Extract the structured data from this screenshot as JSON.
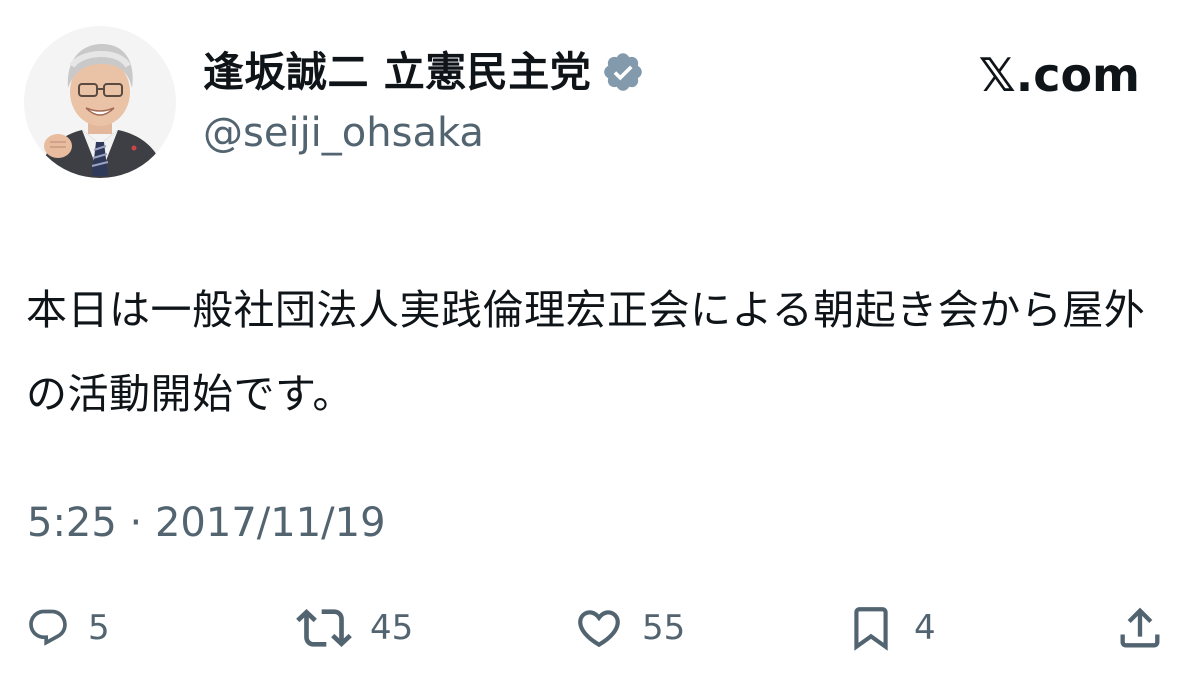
{
  "author": {
    "display_name": "逢坂誠二 立憲民主党",
    "handle": "@seiji_ohsaka",
    "verified": true,
    "verified_color": "#829aab"
  },
  "brand": {
    "label": "𝕏.com"
  },
  "tweet": {
    "text": "本日は一般社団法人実践倫理宏正会による朝起き会から屋外の活動開始です。",
    "timestamp": "5:25 · 2017/11/19"
  },
  "actions": {
    "reply": {
      "icon": "reply-icon",
      "count": "5"
    },
    "retweet": {
      "icon": "retweet-icon",
      "count": "45"
    },
    "like": {
      "icon": "heart-icon",
      "count": "55"
    },
    "bookmark": {
      "icon": "bookmark-icon",
      "count": "4"
    },
    "share": {
      "icon": "share-icon"
    }
  },
  "colors": {
    "text_primary": "#0f1419",
    "text_secondary": "#536471",
    "icon": "#536471"
  }
}
